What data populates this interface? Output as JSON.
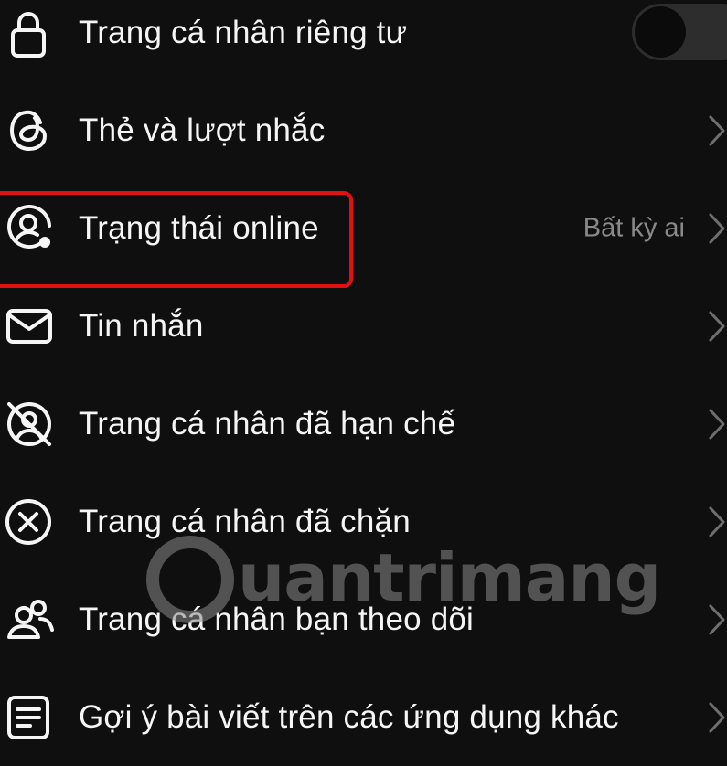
{
  "settings_list": {
    "items": [
      {
        "label": "Trang cá nhân riêng tư",
        "icon": "lock-icon",
        "control": "toggle",
        "toggle_on": false
      },
      {
        "label": "Thẻ và lượt nhắc",
        "icon": "threads-at-icon",
        "control": "chevron"
      },
      {
        "label": "Trạng thái online",
        "icon": "online-status-icon",
        "value": "Bất kỳ ai",
        "control": "chevron",
        "highlighted": true
      },
      {
        "label": "Tin nhắn",
        "icon": "envelope-icon",
        "control": "chevron"
      },
      {
        "label": "Trang cá nhân đã hạn chế",
        "icon": "restricted-profile-icon",
        "control": "chevron"
      },
      {
        "label": "Trang cá nhân đã chặn",
        "icon": "blocked-x-icon",
        "control": "chevron"
      },
      {
        "label": "Trang cá nhân bạn theo dõi",
        "icon": "people-icon",
        "control": "chevron"
      },
      {
        "label": "Gợi ý bài viết trên các ứng dụng khác",
        "icon": "document-lines-icon",
        "control": "chevron"
      }
    ]
  },
  "watermark": {
    "text": "uantrimang"
  },
  "colors": {
    "background": "#0f0f0f",
    "text": "#f5f5f5",
    "secondary_text": "#8a8a8a",
    "highlight_border": "#e11111",
    "toggle_track": "#2d2d2d"
  }
}
